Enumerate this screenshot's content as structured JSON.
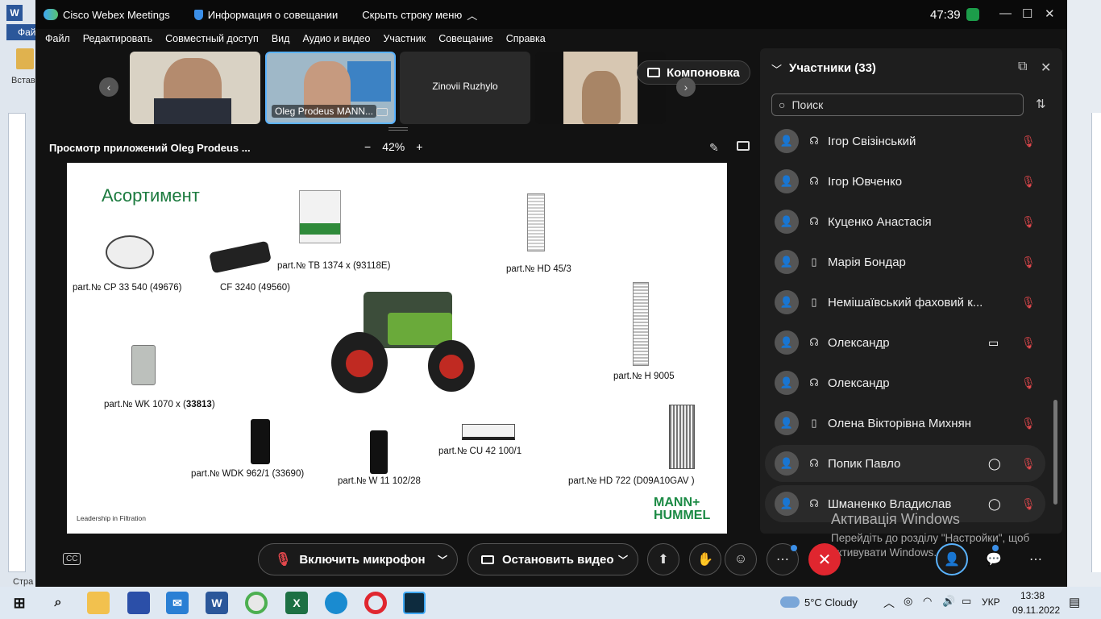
{
  "titlebar": {
    "app_name": "Cisco Webex Meetings",
    "meeting_info": "Информация о совещании",
    "hide_bar": "Скрыть строку меню",
    "timer": "47:39"
  },
  "menu": [
    "Файл",
    "Редактировать",
    "Совместный доступ",
    "Вид",
    "Аудио и видео",
    "Участник",
    "Совещание",
    "Справка"
  ],
  "word_bg": {
    "file": "Фай",
    "paste": "Встав",
    "page": "Стра"
  },
  "videos": {
    "v2_name": "Oleg Prodeus MANN...",
    "v3_name": "Zinovii Ruzhylo",
    "layout_label": "Компоновка"
  },
  "share": {
    "title": "Просмотр приложений Oleg Prodeus ...",
    "zoom": "42%",
    "zoom_minus": "−",
    "zoom_plus": "+"
  },
  "slide": {
    "heading": "Асортимент",
    "labels": {
      "cp": "part.№ CP 33 540 (49676)",
      "cf": "CF 3240 (49560)",
      "tb": "part.№ TB 1374 x (93118E)",
      "hd45": "part.№ HD 45/3",
      "h9005": "part.№ H 9005",
      "wk_prefix": "part.№ WK 1070 x (",
      "wk_bold": "33813",
      "wk_suffix": ")",
      "wdk": "part.№ WDK 962/1 (33690)",
      "w11": "part.№ W 11 102/28",
      "cu": "part.№ CU 42 100/1",
      "hd722": "part.№ HD 722 (D09A10GAV )"
    },
    "footer": "Leadership in Filtration",
    "brand_line1": "MANN+",
    "brand_line2": "HUMMEL"
  },
  "participants": {
    "title": "Участники (33)",
    "search_placeholder": "Поиск",
    "list": [
      {
        "name": "Ігор Свізінський",
        "device": "headset",
        "chat": false,
        "video": false
      },
      {
        "name": "Ігор Ювченко",
        "device": "headset",
        "chat": false,
        "video": false
      },
      {
        "name": "Куценко Анастасія",
        "device": "headset",
        "chat": false,
        "video": false
      },
      {
        "name": "Марія Бондар",
        "device": "phone",
        "chat": false,
        "video": false
      },
      {
        "name": "Немішаївський фаховий к...",
        "device": "phone",
        "chat": false,
        "video": false
      },
      {
        "name": "Олександр",
        "device": "headset",
        "chat": false,
        "video": true
      },
      {
        "name": "Олександр",
        "device": "headset",
        "chat": false,
        "video": false
      },
      {
        "name": "Олена Вікторівна Михнян",
        "device": "phone",
        "chat": false,
        "video": false
      },
      {
        "name": "Попик Павло",
        "device": "headset",
        "chat": true,
        "video": false
      },
      {
        "name": "Шманенко Владислав",
        "device": "headset",
        "chat": true,
        "video": false
      }
    ]
  },
  "watermark": {
    "line1": "Активація Windows",
    "line2": "Перейдіть до розділу \"Настройки\", щоб",
    "line3": "активувати Windows."
  },
  "controls": {
    "mic": "Включить микрофон",
    "video": "Остановить видео"
  },
  "taskbar": {
    "weather": "5°C  Cloudy",
    "lang": "УКР",
    "time": "13:38",
    "date": "09.11.2022"
  },
  "colors": {
    "accent_blue": "#5ab3ff",
    "end_call": "#e0262f",
    "muted_red": "#e5484d",
    "brand_green": "#1b8a44"
  }
}
